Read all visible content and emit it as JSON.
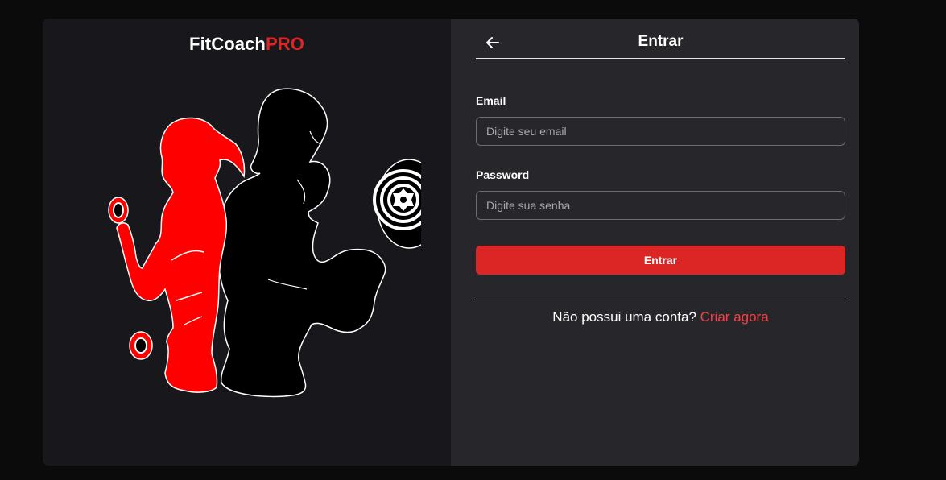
{
  "brand": {
    "name_main": "FitCoach",
    "name_accent": "PRO"
  },
  "hero": {
    "image": "fitness-couple-silhouette"
  },
  "header": {
    "title": "Entrar",
    "back_icon": "arrow-left-icon"
  },
  "form": {
    "email": {
      "label": "Email",
      "placeholder": "Digite seu email",
      "value": ""
    },
    "password": {
      "label": "Password",
      "placeholder": "Digite sua senha",
      "value": ""
    },
    "submit_label": "Entrar"
  },
  "signup": {
    "prompt": "Não possui uma conta?",
    "link_label": "Criar agora"
  },
  "colors": {
    "accent": "#dc2626",
    "link": "#ef4444",
    "left_panel": "#18181c",
    "right_panel": "#27272b",
    "page_bg": "#0b0b0b"
  }
}
